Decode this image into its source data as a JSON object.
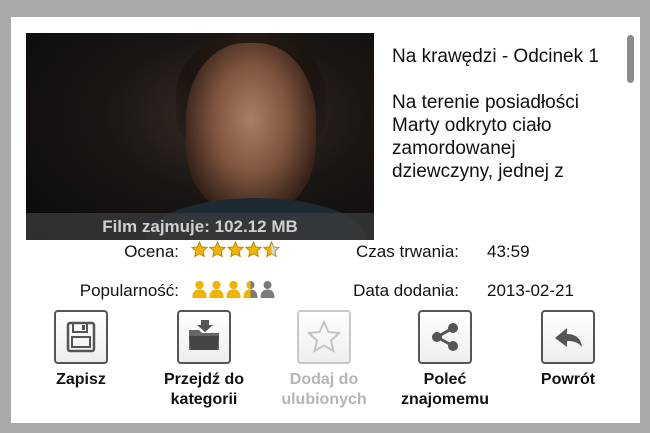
{
  "video": {
    "size_caption": "Film zajmuje: 102.12 MB"
  },
  "episode": {
    "title": "Na krawędzi - Odcinek 1",
    "description": "Na terenie posiadłości Marty odkryto ciało zamordowanej dziewczyny, jednej z"
  },
  "info": {
    "rating_label": "Ocena:",
    "rating_value": 4.5,
    "rating_max": 5,
    "popularity_label": "Popularność:",
    "popularity_value": 3.5,
    "popularity_max": 5,
    "duration_label": "Czas trwania:",
    "duration_value": "43:59",
    "added_label": "Data dodania:",
    "added_value": "2013-02-21"
  },
  "actions": {
    "save": "Zapisz",
    "go_category": "Przejdź do kategorii",
    "add_favorites": "Dodaj do ulubionych",
    "recommend": "Poleć znajomemu",
    "back": "Powrót"
  },
  "colors": {
    "star_fill": "#f2b400",
    "person_active": "#f2b400",
    "person_inactive": "#7a7a7a",
    "disabled": "#b5b5b5"
  },
  "icons": {
    "save": "floppy-disk-icon",
    "category": "folder-arrow-icon",
    "favorites": "star-outline-icon",
    "recommend": "share-icon",
    "back": "back-arrow-icon"
  }
}
